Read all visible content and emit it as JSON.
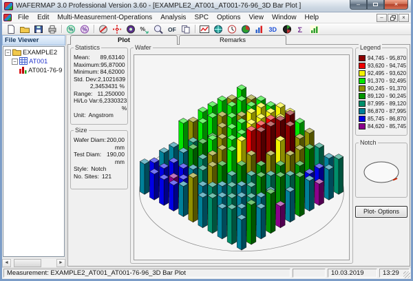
{
  "window": {
    "title": "WAFERMAP 3.0  Professional Version 3.60 - [EXAMPLE2_AT001_AT001-76-96_3D Bar Plot ]"
  },
  "menu": {
    "items": [
      "File",
      "Edit",
      "Multi-Measurement-Operations",
      "Analysis",
      "SPC",
      "Options",
      "View",
      "Window",
      "Help"
    ]
  },
  "toolbar": {
    "buttons": [
      "new-document",
      "open-folder",
      "save-file",
      "print",
      "sep",
      "wafer-percent-green",
      "wafer-percent-purple",
      "sep",
      "wafer-exclude",
      "crosshair",
      "filled-wafer",
      "percent-arrow",
      "zoom-wafer",
      "of-label",
      "copy",
      "sep",
      "trend-chart",
      "wafer-map",
      "clock",
      "pie-chart",
      "histogram",
      "three-d-plot",
      "surface-pie",
      "sigma-stats",
      "bar-chart"
    ]
  },
  "file_viewer": {
    "title": "File Viewer",
    "nodes": [
      {
        "label": "EXAMPLE2",
        "icon": "folder",
        "indent": 0,
        "expandable": true,
        "color": "#111111"
      },
      {
        "label": "AT001",
        "icon": "wafer-grid",
        "indent": 1,
        "expandable": true,
        "color": "#2233cc"
      },
      {
        "label": "AT001-76-9",
        "icon": "measurement",
        "indent": 2,
        "expandable": false,
        "color": "#111111"
      }
    ]
  },
  "tabs": {
    "plot": "Plot",
    "remarks": "Remarks"
  },
  "statistics": {
    "title": "Statistics",
    "rows": [
      {
        "label": "Mean:",
        "value": "89,63140"
      },
      {
        "label": "Maximum:",
        "value": "95,87000"
      },
      {
        "label": "Minimum:",
        "value": "84,62000"
      },
      {
        "label": "",
        "value": ""
      },
      {
        "label": "Std. Dev:",
        "value": "2,1021639"
      },
      {
        "label": "",
        "value": "2,3453431 %"
      },
      {
        "label": "",
        "value": ""
      },
      {
        "label": "Range:",
        "value": "11,250000"
      },
      {
        "label": "Hi/Lo Var:",
        "value": "6,2330323 %"
      },
      {
        "label": "",
        "value": ""
      },
      {
        "label": "Unit:",
        "value": "Angstrom",
        "align": "left"
      }
    ]
  },
  "size": {
    "title": "Size",
    "rows": [
      {
        "label": "Wafer Diam:",
        "value": "200,00 mm"
      },
      {
        "label": "Test Diam:",
        "value": "190,00 mm"
      },
      {
        "label": "Style:",
        "value": "Notch",
        "align": "left"
      },
      {
        "label": "",
        "value": ""
      },
      {
        "label": "No. Sites:",
        "value": "121",
        "align": "left"
      }
    ]
  },
  "wafer_box": {
    "title": "Wafer"
  },
  "legend": {
    "title": "Legend",
    "bins": [
      {
        "color": "#8B0000",
        "label": "94,745 - 95,870"
      },
      {
        "color": "#EE0000",
        "label": "93,620 - 94,745"
      },
      {
        "color": "#F2F200",
        "label": "92,495 - 93,620"
      },
      {
        "color": "#00E600",
        "label": "91,370 - 92,495"
      },
      {
        "color": "#8F8F00",
        "label": "90,245 - 91,370"
      },
      {
        "color": "#009500",
        "label": "89,120 - 90,245"
      },
      {
        "color": "#008F6B",
        "label": "87,995 - 89,120"
      },
      {
        "color": "#008099",
        "label": "86,870 - 87,995"
      },
      {
        "color": "#0000E6",
        "label": "85,745 - 86,870"
      },
      {
        "color": "#8B008B",
        "label": "84,620 - 85,745"
      }
    ]
  },
  "notch": {
    "title": "Notch"
  },
  "plot_options": {
    "label": "Plot- Options"
  },
  "status": {
    "measurement": "Measurement: EXAMPLE2_AT001_AT001-76-96_3D Bar Plot",
    "date": "10.03.2019",
    "time": "13:29"
  },
  "chart_data": {
    "type": "bar",
    "subtype": "3d-wafer-bar-plot",
    "title": "Wafer",
    "unit": "Angstrom",
    "sites": 121,
    "value_range": [
      84.62,
      95.87
    ],
    "color_bins": [
      {
        "max": 85.745,
        "color": "#8B008B"
      },
      {
        "max": 86.87,
        "color": "#0000E6"
      },
      {
        "max": 87.995,
        "color": "#008099"
      },
      {
        "max": 89.12,
        "color": "#008F6B"
      },
      {
        "max": 90.245,
        "color": "#009500"
      },
      {
        "max": 91.37,
        "color": "#8F8F00"
      },
      {
        "max": 92.495,
        "color": "#00E600"
      },
      {
        "max": 93.62,
        "color": "#F2F200"
      },
      {
        "max": 94.745,
        "color": "#EE0000"
      },
      {
        "max": 95.87,
        "color": "#8B0000"
      }
    ],
    "grid": [
      [
        91.9,
        90.8,
        91.9,
        91.9,
        93.0,
        93.0,
        91.9,
        90.8,
        88.5,
        87.3,
        88.5
      ],
      [
        90.8,
        91.9,
        91.9,
        93.0,
        93.0,
        93.0,
        95.3,
        90.8,
        89.6,
        86.2,
        87.3
      ],
      [
        91.9,
        91.9,
        90.8,
        93.0,
        93.0,
        94.1,
        95.3,
        95.3,
        90.8,
        86.2,
        85.1
      ],
      [
        91.9,
        90.8,
        91.9,
        91.9,
        93.0,
        94.1,
        95.3,
        93.0,
        90.8,
        89.6,
        87.3
      ],
      [
        91.9,
        91.9,
        90.8,
        91.9,
        91.9,
        94.1,
        95.3,
        90.8,
        89.6,
        88.5,
        89.6
      ],
      [
        90.8,
        91.9,
        89.6,
        90.8,
        91.9,
        93.0,
        90.8,
        89.6,
        88.5,
        89.6,
        87.3
      ],
      [
        91.9,
        88.5,
        89.6,
        91.9,
        90.8,
        91.9,
        89.6,
        88.5,
        89.6,
        87.3,
        85.1
      ],
      [
        87.3,
        87.3,
        89.6,
        88.5,
        90.8,
        89.6,
        88.5,
        87.3,
        88.5,
        87.3,
        89.6
      ],
      [
        87.3,
        86.2,
        86.2,
        87.3,
        88.5,
        90.8,
        87.3,
        88.5,
        87.3,
        88.5,
        87.3
      ],
      [
        86.2,
        86.2,
        85.1,
        86.2,
        86.2,
        87.3,
        88.5,
        87.3,
        88.5,
        87.3,
        89.6
      ],
      [
        87.3,
        86.2,
        86.2,
        86.2,
        87.3,
        90.8,
        87.3,
        88.5,
        87.3,
        88.5,
        87.3
      ]
    ]
  }
}
